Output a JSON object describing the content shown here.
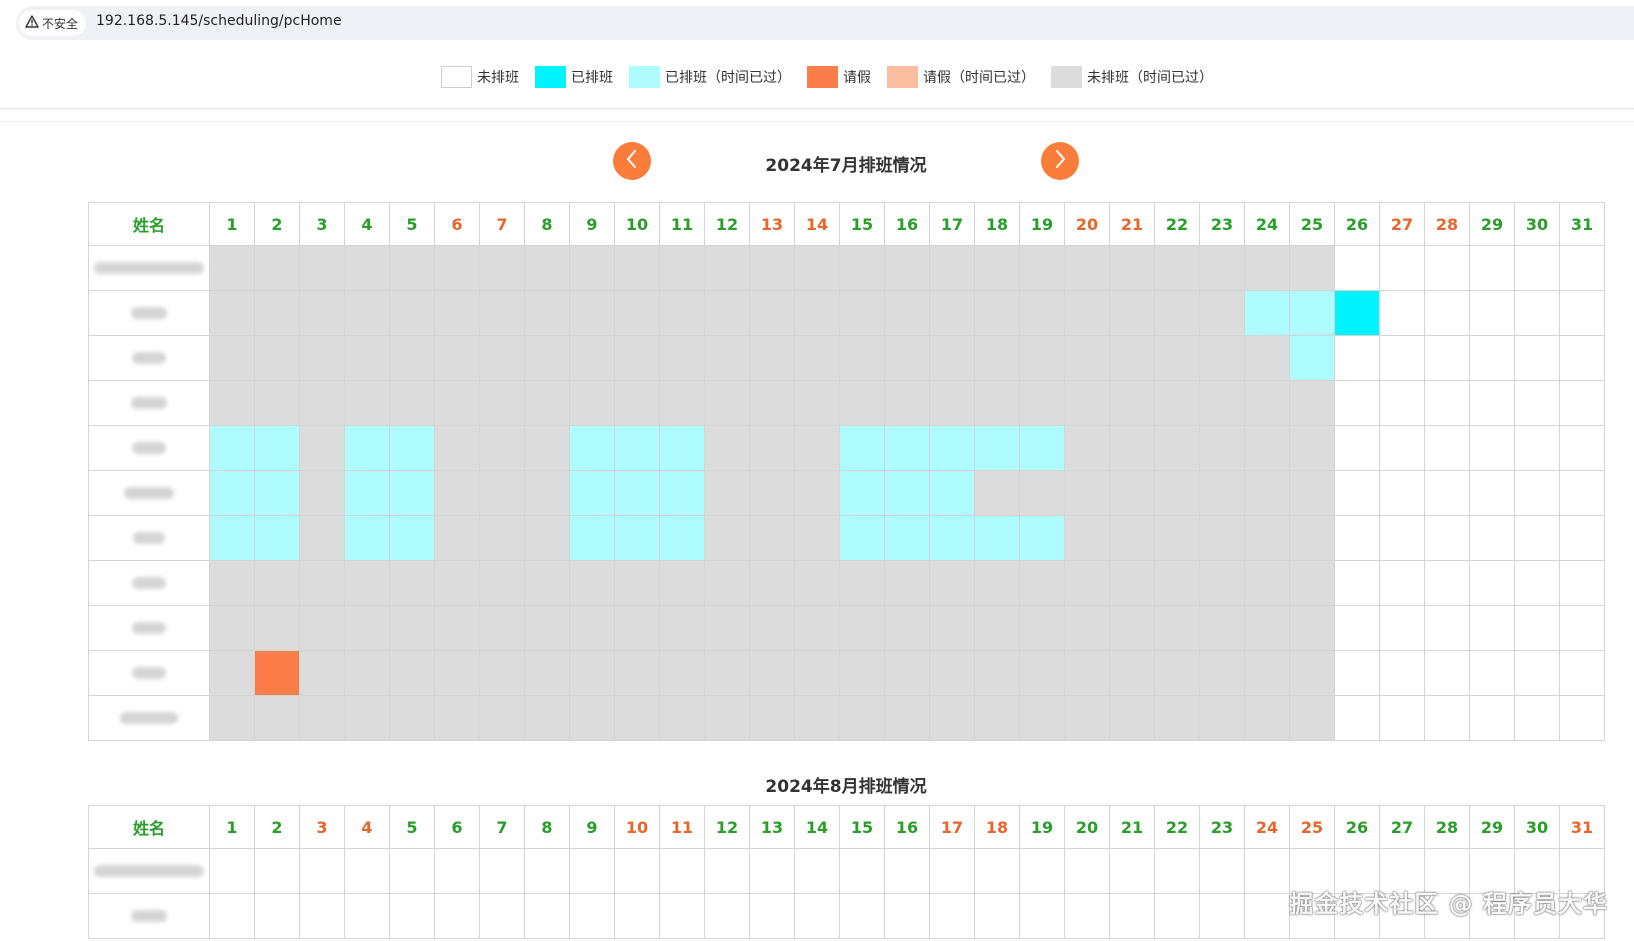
{
  "browser": {
    "security_label": "不安全",
    "url": "192.168.5.145/scheduling/pcHome"
  },
  "legend": [
    {
      "label": "未排班",
      "color": "#ffffff",
      "border": true
    },
    {
      "label": "已排班",
      "color": "#00f4ff"
    },
    {
      "label": "已排班（时间已过）",
      "color": "#aefcfd"
    },
    {
      "label": "请假",
      "color": "#fa7d4a"
    },
    {
      "label": "请假（时间已过）",
      "color": "#fbbca0"
    },
    {
      "label": "未排班（时间已过）",
      "color": "#dcdcdc"
    }
  ],
  "colors": {
    "accent_orange": "#fa7d3c",
    "weekday_green": "#2a9d2a",
    "weekend_orange": "#e8662c",
    "scheduled": "#00f4ff",
    "scheduled_past": "#aefcfd",
    "leave": "#fa7d4a",
    "leave_past": "#fbbca0",
    "unscheduled_past": "#dcdcdc"
  },
  "icons": {
    "prev": "chevron-left-icon",
    "next": "chevron-right-icon",
    "security": "warning-triangle-icon"
  },
  "name_header": "姓名",
  "months": [
    {
      "title": "2024年7月排班情况",
      "days": 31,
      "weekends": [
        6,
        7,
        13,
        14,
        20,
        21,
        27,
        28
      ],
      "rows": [
        "GGGGGGGGGGGGGGGGGGGGGGGGGNNNNNN",
        "GGGGGGGGGGGGGGGGGGGGGGGPPSNNNNN",
        "GGGGGGGGGGGGGGGGGGGGGGGGPNNNNNN",
        "GGGGGGGGGGGGGGGGGGGGGGGGGNNNNNN",
        "PPGPPGGGPPPGGGPPPPPGGGGGGNNNNNN",
        "PPGPPGGGPPPGGGPPPGGGGGGGGNNNNNN",
        "PPGPPGGGPPPGGGPPPPPGGGGGGNNNNNN",
        "GGGGGGGGGGGGGGGGGGGGGGGGGNNNNNN",
        "GGGGGGGGGGGGGGGGGGGGGGGGGNNNNNN",
        "GLGGGGGGGGGGGGGGGGGGGGGGGNNNNNN",
        "GGGGGGGGGGGGGGGGGGGGGGGGGNNNNNN"
      ]
    },
    {
      "title": "2024年8月排班情况",
      "days": 31,
      "weekends": [
        3,
        4,
        10,
        11,
        17,
        18,
        24,
        25,
        31
      ],
      "rows": [
        "NNNNNNNNNNNNNNNNNNNNNNNNNNNNNNN",
        "NNNNNNNNNNNNNNNNNNNNNNNNNNNNNNN"
      ]
    }
  ],
  "watermark": "掘金技术社区 @ 程序员大华"
}
